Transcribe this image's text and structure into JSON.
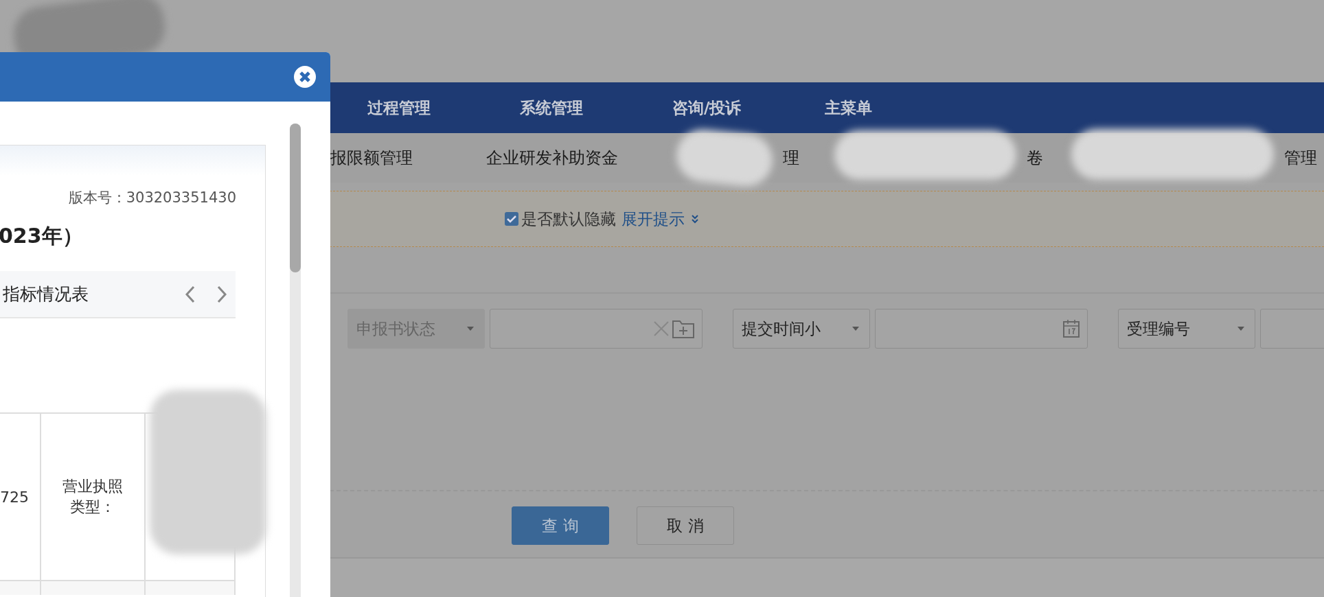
{
  "modal": {
    "version": "版本号：303203351430",
    "title": "023年）",
    "tab_title": "指标情况表",
    "cells": [
      "725",
      "营业执照类型："
    ]
  },
  "nav": {
    "items": [
      "过程管理",
      "系统管理",
      "咨询/投诉",
      "主菜单"
    ]
  },
  "subnav": {
    "items": [
      "报限额管理",
      "企业研发补助资金",
      "理",
      "卷",
      "管理"
    ]
  },
  "hint": {
    "checked": true,
    "label": "是否默认隐藏",
    "link": "展开提示"
  },
  "filters": [
    {
      "select": "申报书状态",
      "disabled": true,
      "kind": "picker"
    },
    {
      "select": "提交时间小",
      "disabled": false,
      "kind": "date"
    },
    {
      "select": "受理编号",
      "disabled": false,
      "kind": "text"
    }
  ],
  "buttons": [
    {
      "label": "查 询",
      "kind": "primary"
    },
    {
      "label": "取 消",
      "kind": "default"
    }
  ]
}
